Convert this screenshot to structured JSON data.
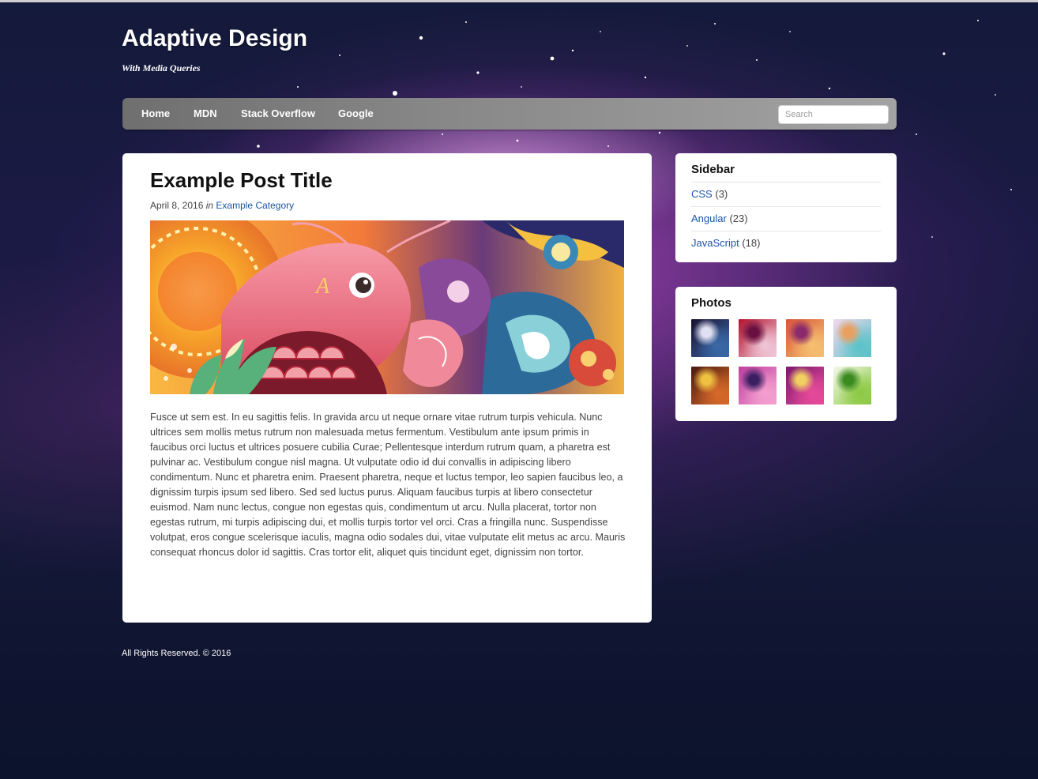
{
  "header": {
    "title": "Adaptive Design",
    "tagline": "With Media Queries"
  },
  "nav": {
    "links": [
      "Home",
      "MDN",
      "Stack Overflow",
      "Google"
    ],
    "search_placeholder": "Search"
  },
  "post": {
    "title": "Example Post Title",
    "date": "April 8, 2016",
    "in_word": "in",
    "category": "Example Category",
    "body": "Fusce ut sem est. In eu sagittis felis. In gravida arcu ut neque ornare vitae rutrum turpis vehicula. Nunc ultrices sem mollis metus rutrum non malesuada metus fermentum. Vestibulum ante ipsum primis in faucibus orci luctus et ultrices posuere cubilia Curae; Pellentesque interdum rutrum quam, a pharetra est pulvinar ac. Vestibulum congue nisl magna. Ut vulputate odio id dui convallis in adipiscing libero condimentum. Nunc et pharetra enim. Praesent pharetra, neque et luctus tempor, leo sapien faucibus leo, a dignissim turpis ipsum sed libero. Sed sed luctus purus. Aliquam faucibus turpis at libero consectetur euismod. Nam nunc lectus, congue non egestas quis, condimentum ut arcu. Nulla placerat, tortor non egestas rutrum, mi turpis adipiscing dui, et mollis turpis tortor vel orci. Cras a fringilla nunc. Suspendisse volutpat, eros congue scelerisque iaculis, magna odio sodales dui, vitae vulputate elit metus ac arcu. Mauris consequat rhoncus dolor id sagittis. Cras tortor elit, aliquet quis tincidunt eget, dignissim non tortor."
  },
  "sidebar": {
    "title": "Sidebar",
    "items": [
      {
        "label": "CSS",
        "count": "(3)"
      },
      {
        "label": "Angular",
        "count": "(23)"
      },
      {
        "label": "JavaScript",
        "count": "(18)"
      }
    ]
  },
  "photos": {
    "title": "Photos",
    "thumb_colors": [
      [
        "#1a1030",
        "#3a6aa8",
        "#e0e0f0"
      ],
      [
        "#b3122e",
        "#f0c8d8",
        "#6a1040"
      ],
      [
        "#d8553a",
        "#f6c070",
        "#8a2a6a"
      ],
      [
        "#f3d8ec",
        "#5bc2c8",
        "#e8a060"
      ],
      [
        "#4a1a10",
        "#d86a2a",
        "#f0c040"
      ],
      [
        "#c040a0",
        "#f5a0d0",
        "#3a2060"
      ],
      [
        "#7a1a70",
        "#e84a9a",
        "#f0d060"
      ],
      [
        "#f4f8e8",
        "#8ac840",
        "#3a8a20"
      ]
    ]
  },
  "footer": {
    "text": "All Rights Reserved. © 2016"
  }
}
